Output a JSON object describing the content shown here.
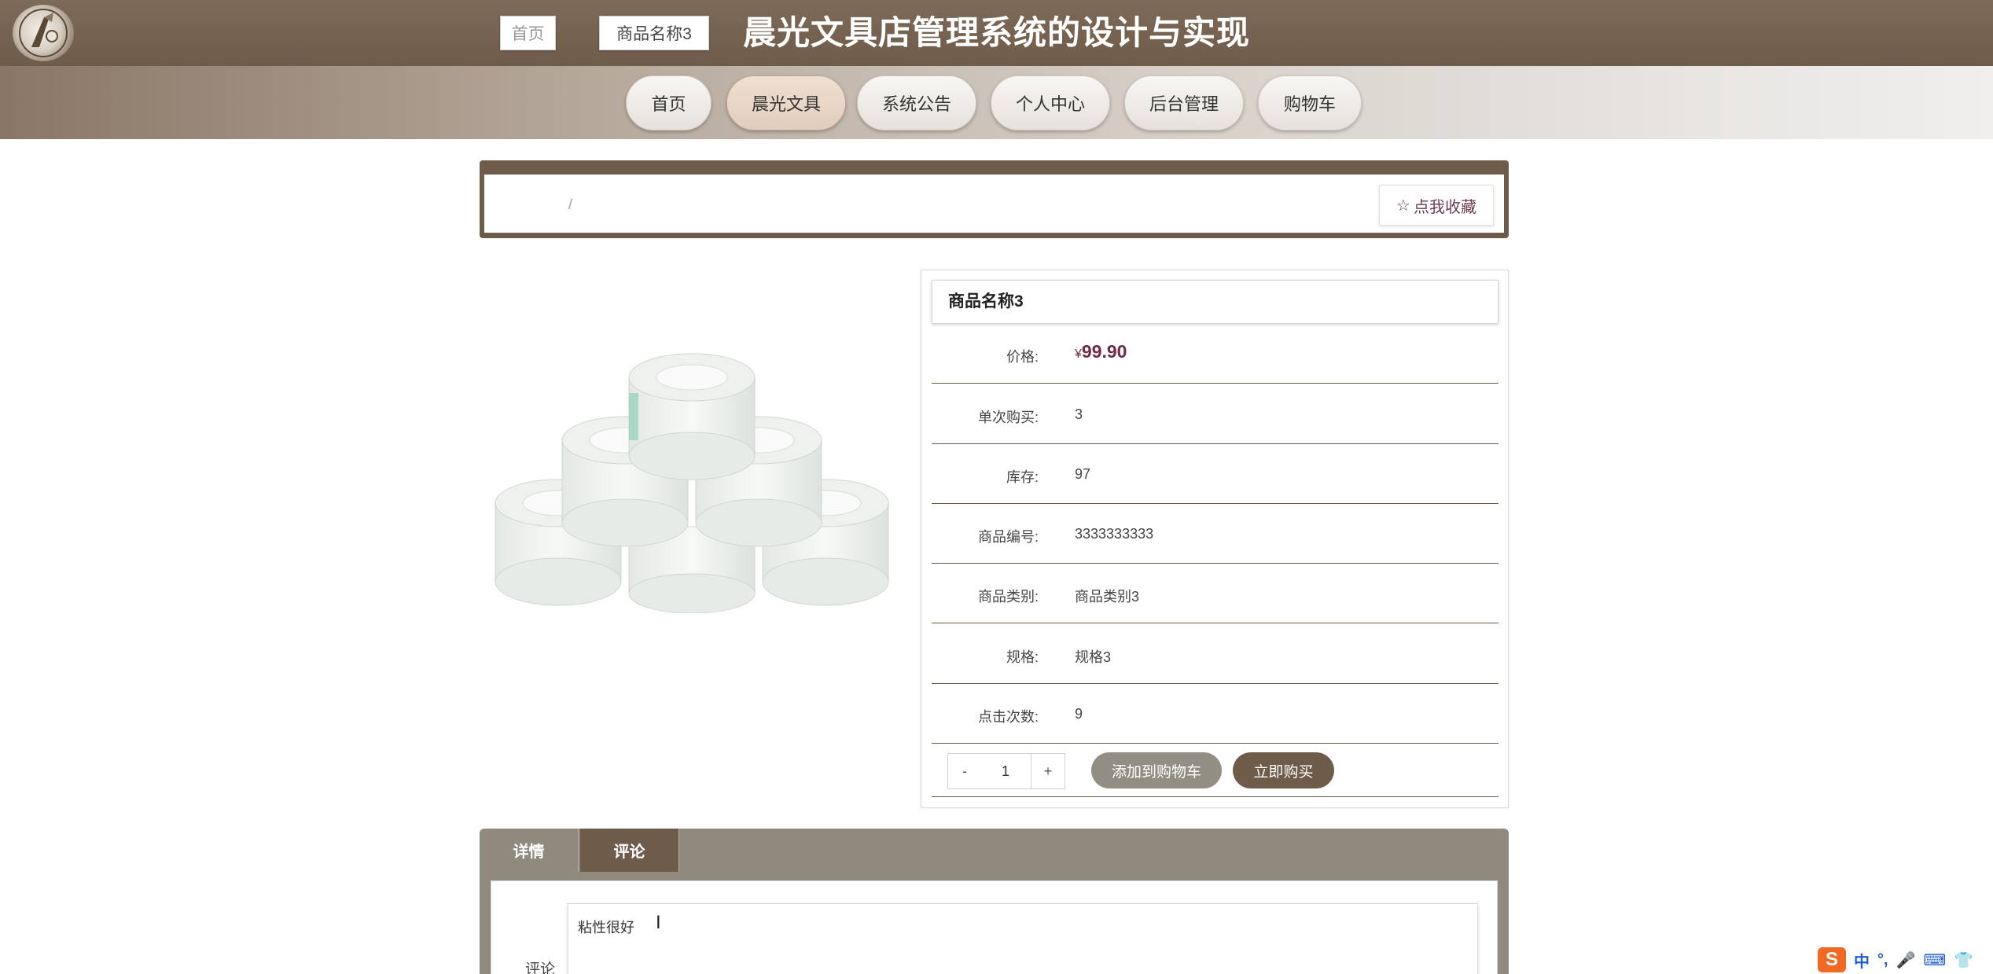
{
  "header": {
    "site_title": "晨光文具店管理系统的设计与实现",
    "logo_icon": "pen-nib-logo-icon"
  },
  "nav": {
    "items": [
      {
        "label": "首页",
        "active": false
      },
      {
        "label": "晨光文具",
        "active": true
      },
      {
        "label": "系统公告",
        "active": false
      },
      {
        "label": "个人中心",
        "active": false
      },
      {
        "label": "后台管理",
        "active": false
      },
      {
        "label": "购物车",
        "active": false
      }
    ]
  },
  "breadcrumb": {
    "home": "首页",
    "separator": "/",
    "current": "商品名称3"
  },
  "favorite": {
    "icon": "star-outline-icon",
    "label": "点我收藏"
  },
  "product": {
    "name": "商品名称3",
    "image_icon": "tape-rolls-image",
    "fields": [
      {
        "label": "价格:",
        "value": "99.90",
        "currency": "¥",
        "is_price": true
      },
      {
        "label": "单次购买:",
        "value": "3"
      },
      {
        "label": "库存:",
        "value": "97"
      },
      {
        "label": "商品编号:",
        "value": "3333333333"
      },
      {
        "label": "商品类别:",
        "value": "商品类别3"
      },
      {
        "label": "规格:",
        "value": "规格3"
      },
      {
        "label": "点击次数:",
        "value": "9"
      }
    ]
  },
  "purchase": {
    "minus": "-",
    "quantity": "1",
    "plus": "+",
    "add_to_cart": "添加到购物车",
    "buy_now": "立即购买"
  },
  "tabs": {
    "items": [
      {
        "label": "详情",
        "active": false
      },
      {
        "label": "评论",
        "active": true
      }
    ]
  },
  "comment": {
    "label": "评论",
    "value": "粘性很好"
  },
  "ime": {
    "logo": "S",
    "items": [
      "中",
      "°,",
      "mic-icon",
      "keyboard-icon",
      "shirt-icon"
    ]
  },
  "colors": {
    "brand_brown": "#6e5b4a",
    "price_color": "#6e2a47",
    "tab_bar": "#908a7e"
  }
}
